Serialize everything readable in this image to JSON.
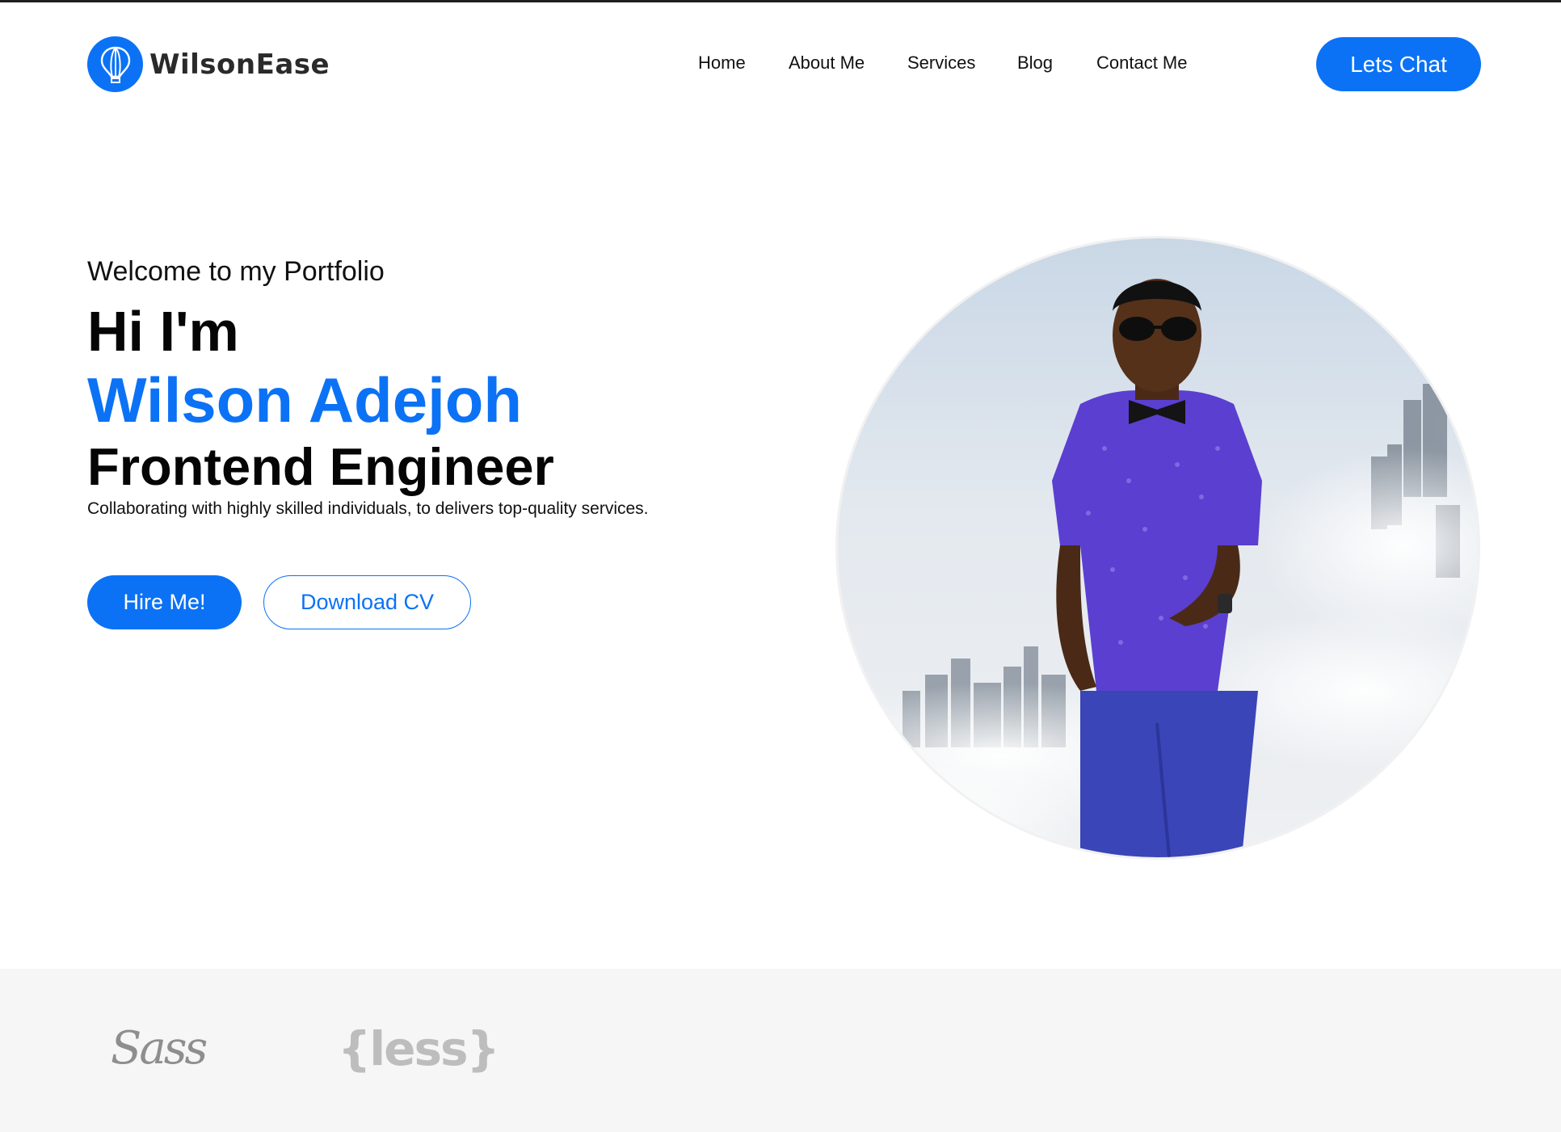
{
  "header": {
    "brand": "WilsonEase",
    "nav": [
      "Home",
      "About Me",
      "Services",
      "Blog",
      "Contact Me"
    ],
    "cta_label": "Lets Chat"
  },
  "hero": {
    "welcome": "Welcome to my Portfolio",
    "greeting": "Hi I'm",
    "name": "Wilson Adejoh",
    "role": "Frontend Engineer",
    "tagline": "Collaborating with highly skilled individuals, to delivers top-quality services.",
    "hire_label": "Hire Me!",
    "cv_label": "Download CV"
  },
  "tech_logos": [
    "Sass",
    "{less}"
  ],
  "colors": {
    "accent": "#0b72f5",
    "text": "#0b0b0b",
    "strip_bg": "#f6f6f6"
  }
}
